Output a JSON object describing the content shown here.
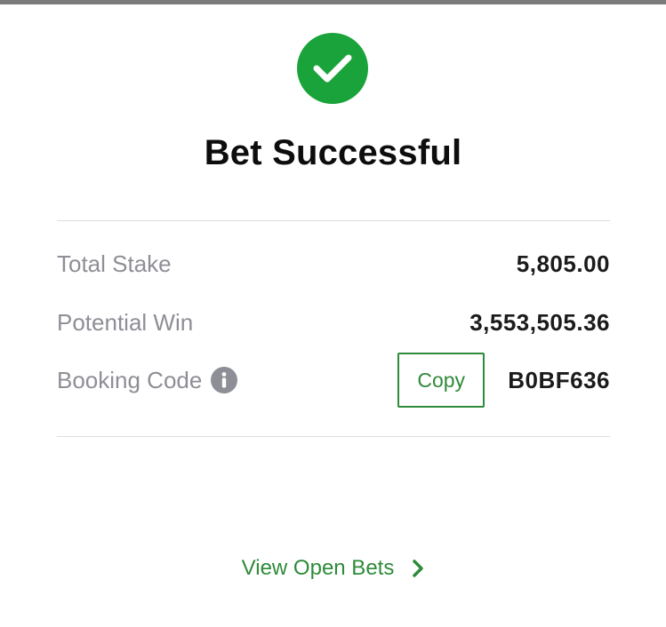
{
  "header": {
    "title": "Bet Successful",
    "success_icon": "check-circle-icon"
  },
  "summary": {
    "total_stake": {
      "label": "Total Stake",
      "value": "5,805.00"
    },
    "potential_win": {
      "label": "Potential Win",
      "value": "3,553,505.36"
    },
    "booking_code": {
      "label": "Booking Code",
      "info_icon": "info-icon",
      "copy_label": "Copy",
      "value": "B0BF636"
    }
  },
  "footer": {
    "view_open_bets_label": "View Open Bets",
    "chevron_icon": "chevron-right-icon"
  },
  "colors": {
    "success": "#1aa33a",
    "accent_green": "#2e8b3a",
    "label_gray": "#8e8e96",
    "value_dark": "#1b1b1b"
  }
}
